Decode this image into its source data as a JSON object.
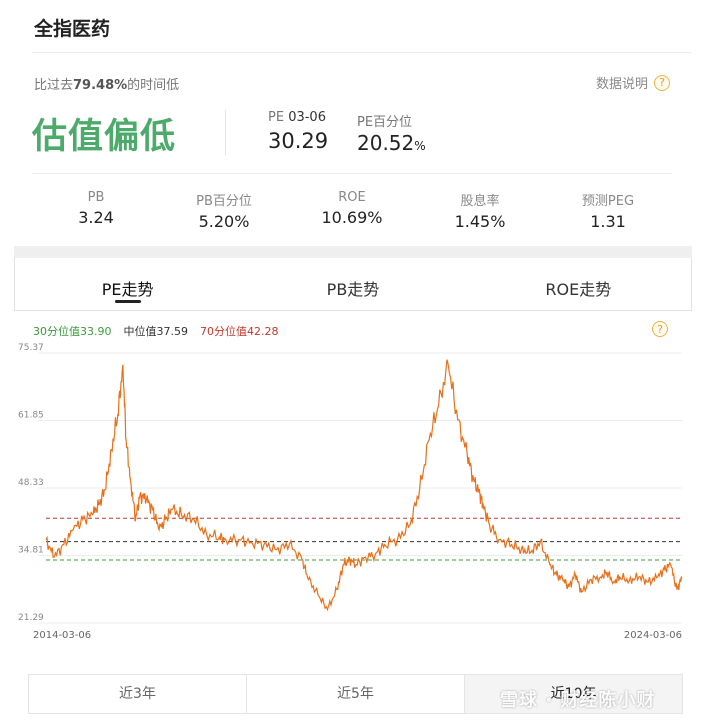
{
  "header": {
    "title": "全指医药"
  },
  "summary": {
    "compare_prefix": "比过去",
    "compare_pct": "79.48%",
    "compare_suffix": "的时间低",
    "explain_label": "数据说明",
    "status": "估值偏低",
    "pe_label": "PE",
    "pe_date": "03-06",
    "pe_value": "30.29",
    "pe_pct_label": "PE百分位",
    "pe_pct_value": "20.52",
    "pe_pct_unit": "%"
  },
  "metrics": [
    {
      "label": "PB",
      "value": "3.24"
    },
    {
      "label": "PB百分位",
      "value": "5.20%"
    },
    {
      "label": "ROE",
      "value": "10.69%"
    },
    {
      "label": "股息率",
      "value": "1.45%"
    },
    {
      "label": "预测PEG",
      "value": "1.31"
    }
  ],
  "tabs": [
    {
      "label": "PE走势",
      "active": true
    },
    {
      "label": "PB走势",
      "active": false
    },
    {
      "label": "ROE走势",
      "active": false
    }
  ],
  "legend": {
    "p30": "30分位值33.90",
    "median": "中位值37.59",
    "p70": "70分位值42.28"
  },
  "ranges": [
    "近3年",
    "近5年",
    "近10年"
  ],
  "watermark": "雪球 · 财经陈小财",
  "colors": {
    "status": "#4caa6a",
    "line": "#e8701a",
    "p30": "#3b9b3b",
    "median": "#333333",
    "p70": "#c0392b"
  },
  "chart_data": {
    "type": "line",
    "x_start": "2014-03-06",
    "x_end": "2024-03-06",
    "y_ticks": [
      "75.37",
      "61.85",
      "48.33",
      "34.81",
      "21.29"
    ],
    "ylim": [
      21.29,
      75.37
    ],
    "reference_lines": [
      {
        "name": "30分位值",
        "value": 33.9
      },
      {
        "name": "中位值",
        "value": 37.59
      },
      {
        "name": "70分位值",
        "value": 42.28
      }
    ],
    "series": [
      {
        "x": [
          2014.17,
          2014.3,
          2014.45,
          2014.6,
          2014.75,
          2014.9,
          2015.0,
          2015.1,
          2015.2,
          2015.3,
          2015.38,
          2015.43,
          2015.5,
          2015.58,
          2015.65,
          2015.75,
          2015.85,
          2015.95,
          2016.05,
          2016.15,
          2016.3,
          2016.5,
          2016.7,
          2016.9,
          2017.0,
          2017.2,
          2017.4,
          2017.6,
          2017.8,
          2018.0,
          2018.2,
          2018.3,
          2018.45,
          2018.6,
          2018.75,
          2018.85,
          2018.95,
          2019.05,
          2019.2,
          2019.35,
          2019.5,
          2019.7,
          2019.9,
          2020.05,
          2020.2,
          2020.35,
          2020.5,
          2020.65,
          2020.8,
          2020.9,
          2021.0,
          2021.05,
          2021.15,
          2021.3,
          2021.5,
          2021.65,
          2021.8,
          2021.95,
          2022.1,
          2022.2,
          2022.3,
          2022.4,
          2022.5,
          2022.6,
          2022.75,
          2022.9,
          2023.0,
          2023.1,
          2023.2,
          2023.35,
          2023.5,
          2023.65,
          2023.8,
          2023.9,
          2024.0,
          2024.1,
          2024.18
        ],
        "y": [
          38,
          34.5,
          37,
          40,
          42,
          43,
          45,
          48,
          56,
          63,
          73,
          58,
          50,
          42,
          47,
          46,
          44,
          40,
          42,
          44,
          43,
          42,
          39,
          38.5,
          38,
          38,
          37.5,
          37,
          36,
          37,
          34,
          30,
          27,
          24,
          28,
          33,
          34,
          33,
          34.5,
          35,
          37,
          38,
          41,
          48,
          58,
          65,
          73,
          62,
          55,
          50,
          47,
          45,
          41,
          38,
          37,
          36,
          35.5,
          37.5,
          33,
          31,
          30,
          28.5,
          31,
          27.5,
          30,
          30.5,
          31.5,
          29.5,
          30.5,
          29.8,
          30.5,
          29.5,
          30.5,
          32,
          33,
          28,
          30.3
        ]
      }
    ]
  }
}
